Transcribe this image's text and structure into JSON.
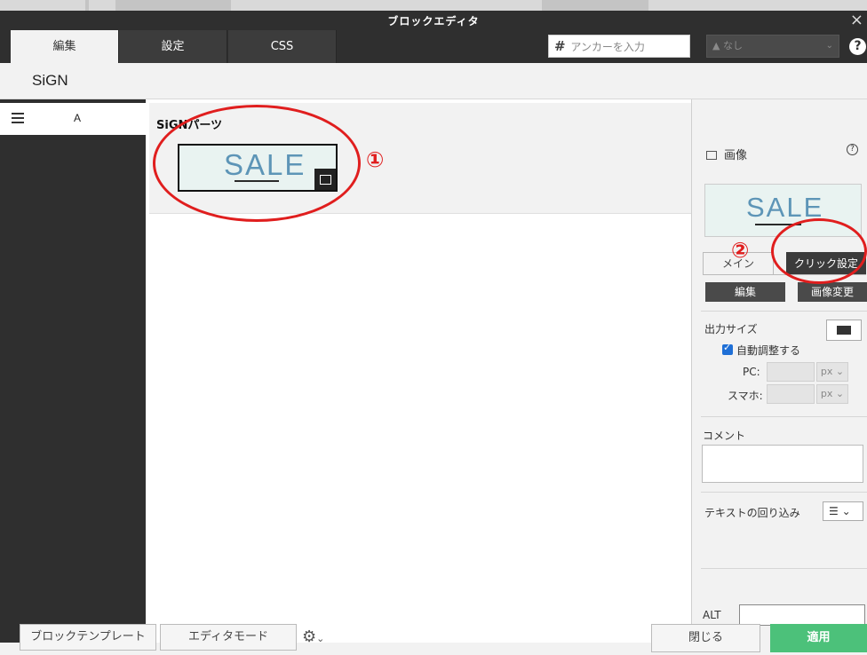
{
  "dialog": {
    "title": "ブロックエディタ",
    "close": "×"
  },
  "tabs": [
    {
      "label": "編集",
      "active": true
    },
    {
      "label": "設定",
      "active": false
    },
    {
      "label": "CSS",
      "active": false
    }
  ],
  "anchor": {
    "hash": "#",
    "placeholder": "アンカーを入力"
  },
  "class_select": {
    "value": "なし",
    "icon": "tag-icon"
  },
  "help": "?",
  "subtitle": "SiGN",
  "sidebar": {
    "item_label": "A"
  },
  "block": {
    "title": "SiGNパーツ",
    "thumb_text": "SALE"
  },
  "annotations": {
    "one": "①",
    "two": "②"
  },
  "panel": {
    "header": "画像",
    "help": "?",
    "preview_text": "SALE",
    "tab_main": "メイン",
    "tab_click": "クリック設定",
    "btn_edit": "編集",
    "btn_change": "画像変更",
    "output_size": "出力サイズ",
    "auto_adjust": "自動調整する",
    "pc_label": "PC:",
    "sp_label": "スマホ:",
    "unit": "px",
    "comment": "コメント",
    "wrap_label": "テキストの回り込み",
    "alt_label": "ALT"
  },
  "footer": {
    "template": "ブロックテンプレート",
    "editor_mode": "エディタモード",
    "close": "閉じる",
    "apply": "適用"
  },
  "colors": {
    "accent": "#4cc17a",
    "annotation": "#e01e1e",
    "dark": "#2f2f2f"
  }
}
